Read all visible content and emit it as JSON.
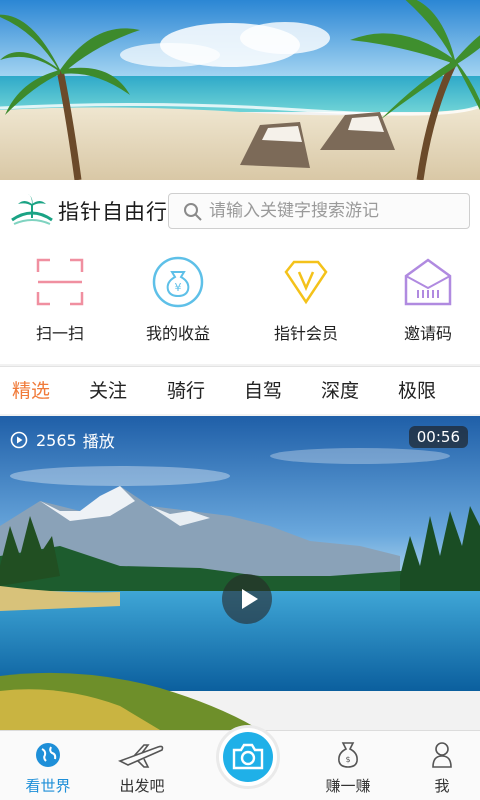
{
  "brand": {
    "name": "指针自由行"
  },
  "search": {
    "placeholder": "请输入关键字搜索游记",
    "icon": "search-icon"
  },
  "quick_actions": [
    {
      "label": "扫一扫",
      "icon": "scan-icon",
      "color": "#f08fa0"
    },
    {
      "label": "我的收益",
      "icon": "money-bag-icon",
      "color": "#5ec0e8"
    },
    {
      "label": "指针会员",
      "icon": "vip-diamond-icon",
      "color": "#f4c21a"
    },
    {
      "label": "邀请码",
      "icon": "invite-envelope-icon",
      "color": "#b08ae0"
    }
  ],
  "tabs": [
    {
      "label": "精选",
      "active": true
    },
    {
      "label": "关注",
      "active": false
    },
    {
      "label": "骑行",
      "active": false
    },
    {
      "label": "自驾",
      "active": false
    },
    {
      "label": "深度",
      "active": false
    },
    {
      "label": "极限",
      "active": false
    }
  ],
  "video": {
    "play_count": "2565",
    "play_label": "播放",
    "duration": "00:56"
  },
  "bottom_nav": [
    {
      "label": "看世界",
      "icon": "globe-icon",
      "active": true
    },
    {
      "label": "出发吧",
      "icon": "airplane-icon",
      "active": false
    },
    {
      "label": "",
      "icon": "camera-icon",
      "active": false
    },
    {
      "label": "赚一赚",
      "icon": "money-bag-icon",
      "active": false
    },
    {
      "label": "我",
      "icon": "person-icon",
      "active": false
    }
  ],
  "colors": {
    "accent": "#f07b3a",
    "nav_active": "#1e8fd8",
    "camera": "#1fb0e8"
  }
}
